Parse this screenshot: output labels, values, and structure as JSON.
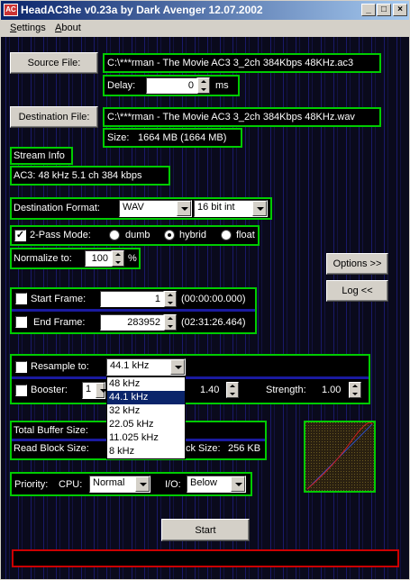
{
  "window": {
    "title": "HeadAC3he v0.23a by Dark Avenger 12.07.2002",
    "min_glyph": "_",
    "max_glyph": "□",
    "close_glyph": "×"
  },
  "menu": {
    "settings": "Settings",
    "about": "About"
  },
  "source": {
    "button": "Source File:",
    "path": "C:\\***rman - The Movie AC3 3_2ch 384Kbps 48KHz.ac3",
    "delay_label": "Delay:",
    "delay_value": "0",
    "delay_unit": "ms"
  },
  "destination": {
    "button": "Destination File:",
    "path": "C:\\***rman - The Movie AC3 3_2ch 384Kbps 48KHz.wav",
    "size_label": "Size:",
    "size_value": "1664 MB  (1664 MB)"
  },
  "stream": {
    "header": "Stream Info",
    "info": "AC3:  48 kHz   5.1 ch   384 kbps"
  },
  "format": {
    "label": "Destination Format:",
    "type": "WAV",
    "bits": "16 bit int"
  },
  "twopass": {
    "label": "2-Pass Mode:",
    "checked": true,
    "opt1": "dumb",
    "opt2": "hybrid",
    "opt3": "float",
    "selected": "hybrid"
  },
  "normalize": {
    "label": "Normalize to:",
    "value": "100",
    "unit": "%"
  },
  "buttons": {
    "options": "Options >>",
    "log": "Log <<",
    "start": "Start"
  },
  "frames": {
    "start_label": "Start Frame:",
    "start_value": "1",
    "start_time": "(00:00:00.000)",
    "end_label": "End Frame:",
    "end_value": "283952",
    "end_time": "(02:31:26.464)"
  },
  "resample": {
    "label": "Resample to:",
    "value": "44.1 kHz",
    "options": [
      "48 kHz",
      "44.1 kHz",
      "32 kHz",
      "22.05 kHz",
      "11.025 kHz",
      "8 kHz"
    ],
    "selected_index": 1
  },
  "booster": {
    "label": "Booster:",
    "value": "1",
    "gain_value": "1.40",
    "strength_label": "Strength:",
    "strength_value": "1.00"
  },
  "buffer": {
    "total_label": "Total Buffer Size:",
    "read_label": "Read Block Size:",
    "write_label_tail": "ck Size:",
    "write_value": "256 KB"
  },
  "priority": {
    "label": "Priority:",
    "cpu_label": "CPU:",
    "cpu_value": "Normal",
    "io_label": "I/O:",
    "io_value": "Below"
  },
  "colors": {
    "accent_border": "#00cc00",
    "progress_border": "#cc0000",
    "title_bar": "#0a246a"
  }
}
